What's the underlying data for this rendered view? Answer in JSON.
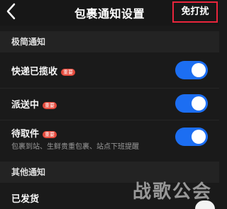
{
  "header": {
    "title": "包裹通知设置",
    "dnd_label": "免打扰"
  },
  "sections": [
    {
      "title": "极简通知"
    },
    {
      "title": "其他通知"
    }
  ],
  "rows": [
    {
      "label": "快递已揽收",
      "badge": "重要",
      "enabled": true
    },
    {
      "label": "派送中",
      "badge": "重要",
      "enabled": true
    },
    {
      "label": "待取件",
      "badge": "重要",
      "desc": "包裹到站、生鲜贵重包裹、站点下班提醒",
      "enabled": true
    },
    {
      "label": "已发货"
    }
  ],
  "watermark": "战歌公会",
  "colors": {
    "accent": "#1c6ef2",
    "badge": "#e64a3c",
    "highlight_border": "#e8253c"
  }
}
